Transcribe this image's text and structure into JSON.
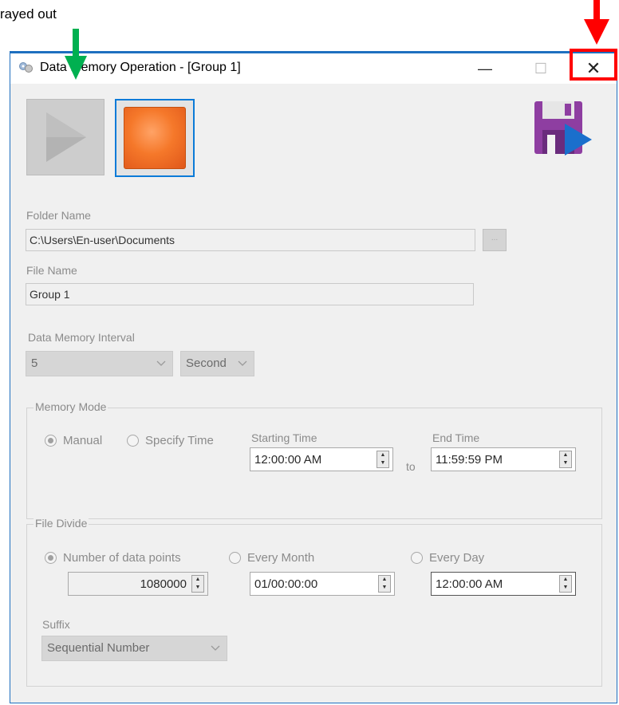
{
  "annotation": {
    "text": "rayed out"
  },
  "window": {
    "title": "Data Memory Operation - [Group 1]",
    "buttons": {
      "minimize": "—",
      "maximize": "☐",
      "close": "✕"
    },
    "accent_color": "#1e6fbf"
  },
  "toolbar": {
    "play_icon": "play-icon",
    "stop_icon": "stop-icon",
    "save_icon": "save-icon"
  },
  "form": {
    "folder_label": "Folder Name",
    "folder_value": "C:\\Users\\En-user\\Documents",
    "browse_label": "...",
    "file_label": "File Name",
    "file_value": "Group 1",
    "interval_label": "Data Memory Interval",
    "interval_value": "5",
    "interval_unit": "Second"
  },
  "memory_mode": {
    "legend": "Memory Mode",
    "manual_label": "Manual",
    "specify_label": "Specify Time",
    "selected": "Manual",
    "start_label": "Starting Time",
    "start_value": "12:00:00 AM",
    "to_label": "to",
    "end_label": "End Time",
    "end_value": "11:59:59 PM"
  },
  "file_divide": {
    "legend": "File Divide",
    "points_label": "Number of data points",
    "points_value": "1080000",
    "month_label": "Every Month",
    "month_value": "01/00:00:00",
    "day_label": "Every Day",
    "day_value": "12:00:00 AM",
    "selected": "Number of data points",
    "suffix_label": "Suffix",
    "suffix_value": "Sequential Number"
  },
  "colors": {
    "highlight_red": "#ff0000",
    "arrow_green": "#00b050",
    "stop_orange": "#f5782a"
  }
}
